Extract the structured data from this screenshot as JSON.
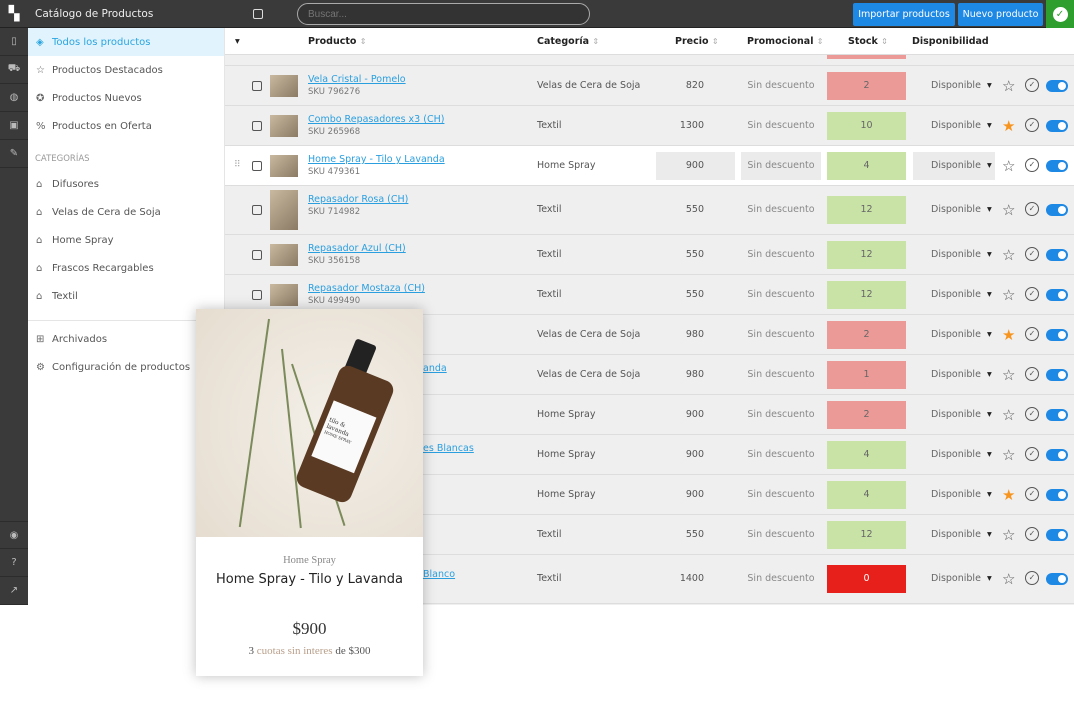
{
  "header": {
    "title": "Catálogo de Productos",
    "search_placeholder": "Buscar...",
    "import_label": "Importar productos",
    "new_label": "Nuevo producto"
  },
  "rail": {
    "top": [
      "document-icon",
      "cart-icon",
      "palette-icon",
      "image-icon",
      "wrench-icon"
    ],
    "bottom": [
      "user-icon",
      "help-icon",
      "external-link-icon"
    ]
  },
  "sidebar": {
    "items": [
      {
        "label": "Todos los productos",
        "icon": "tags-icon",
        "active": true
      },
      {
        "label": "Productos Destacados",
        "icon": "star-icon"
      },
      {
        "label": "Productos Nuevos",
        "icon": "badge-check-icon"
      },
      {
        "label": "Productos en Oferta",
        "icon": "discount-icon"
      }
    ],
    "categories_label": "CATEGORÍAS",
    "categories": [
      "Difusores",
      "Velas de Cera de Soja",
      "Home Spray",
      "Frascos Recargables",
      "Textil"
    ],
    "footer": [
      {
        "label": "Archivados",
        "icon": "archive-icon"
      },
      {
        "label": "Configuración de productos",
        "icon": "gear-icon"
      }
    ]
  },
  "table": {
    "columns": {
      "product": "Producto",
      "category": "Categoría",
      "price": "Precio",
      "promo": "Promocional",
      "stock": "Stock",
      "availability": "Disponibilidad"
    },
    "rows": [
      {
        "name": "Vela Cristal - Pomelo",
        "sku": "SKU 796276",
        "category": "Velas de Cera de Soja",
        "price": "820",
        "promo": "Sin descuento",
        "stock": "2",
        "level": "low",
        "availability": "Disponible",
        "featured": false
      },
      {
        "name": "Combo Repasadores x3 (CH)",
        "sku": "SKU 265968",
        "category": "Textil",
        "price": "1300",
        "promo": "Sin descuento",
        "stock": "10",
        "level": "ok",
        "availability": "Disponible",
        "featured": true
      },
      {
        "name": "Home Spray - Tilo y Lavanda",
        "sku": "SKU 479361",
        "category": "Home Spray",
        "price": "900",
        "promo": "Sin descuento",
        "stock": "4",
        "level": "ok",
        "availability": "Disponible",
        "featured": false,
        "hover": true
      },
      {
        "name": "Repasador Rosa (CH)",
        "sku": "SKU 714982",
        "category": "Textil",
        "price": "550",
        "promo": "Sin descuento",
        "stock": "12",
        "level": "ok",
        "availability": "Disponible",
        "featured": false,
        "tall": true
      },
      {
        "name": "Repasador Azul (CH)",
        "sku": "SKU 356158",
        "category": "Textil",
        "price": "550",
        "promo": "Sin descuento",
        "stock": "12",
        "level": "ok",
        "availability": "Disponible",
        "featured": false
      },
      {
        "name": "Repasador Mostaza (CH)",
        "sku": "SKU 499490",
        "category": "Textil",
        "price": "550",
        "promo": "Sin descuento",
        "stock": "12",
        "level": "ok",
        "availability": "Disponible",
        "featured": false
      },
      {
        "name": "",
        "sku": "",
        "category": "Velas de Cera de Soja",
        "price": "980",
        "promo": "Sin descuento",
        "stock": "2",
        "level": "low",
        "availability": "Disponible",
        "featured": true
      },
      {
        "name": "anda",
        "sku": "",
        "category": "Velas de Cera de Soja",
        "price": "980",
        "promo": "Sin descuento",
        "stock": "1",
        "level": "low",
        "availability": "Disponible",
        "featured": false
      },
      {
        "name": "",
        "sku": "",
        "category": "Home Spray",
        "price": "900",
        "promo": "Sin descuento",
        "stock": "2",
        "level": "low",
        "availability": "Disponible",
        "featured": false
      },
      {
        "name": "es Blancas",
        "sku": "",
        "category": "Home Spray",
        "price": "900",
        "promo": "Sin descuento",
        "stock": "4",
        "level": "ok",
        "availability": "Disponible",
        "featured": false
      },
      {
        "name": "",
        "sku": "",
        "category": "Home Spray",
        "price": "900",
        "promo": "Sin descuento",
        "stock": "4",
        "level": "ok",
        "availability": "Disponible",
        "featured": true
      },
      {
        "name": "",
        "sku": "",
        "category": "Textil",
        "price": "550",
        "promo": "Sin descuento",
        "stock": "12",
        "level": "ok",
        "availability": "Disponible",
        "featured": false
      },
      {
        "name": "Blanco",
        "sku": "",
        "category": "Textil",
        "price": "1400",
        "promo": "Sin descuento",
        "stock": "0",
        "level": "out",
        "availability": "Disponible",
        "featured": false,
        "tall": true
      }
    ]
  },
  "colors": {
    "low": "#ec9a97",
    "ok": "#c9e3a7",
    "out": "#e8201c",
    "accent": "#1e88e5",
    "featured": "#f7941d"
  },
  "card": {
    "category": "Home Spray",
    "name": "Home Spray - Tilo y Lavanda",
    "price": "$900",
    "installments_count": "3",
    "installments_text": "cuotas sin interes",
    "installments_of": "de $300",
    "label_text": "tilo & lavanda",
    "label_sub": "HOME SPRAY"
  }
}
